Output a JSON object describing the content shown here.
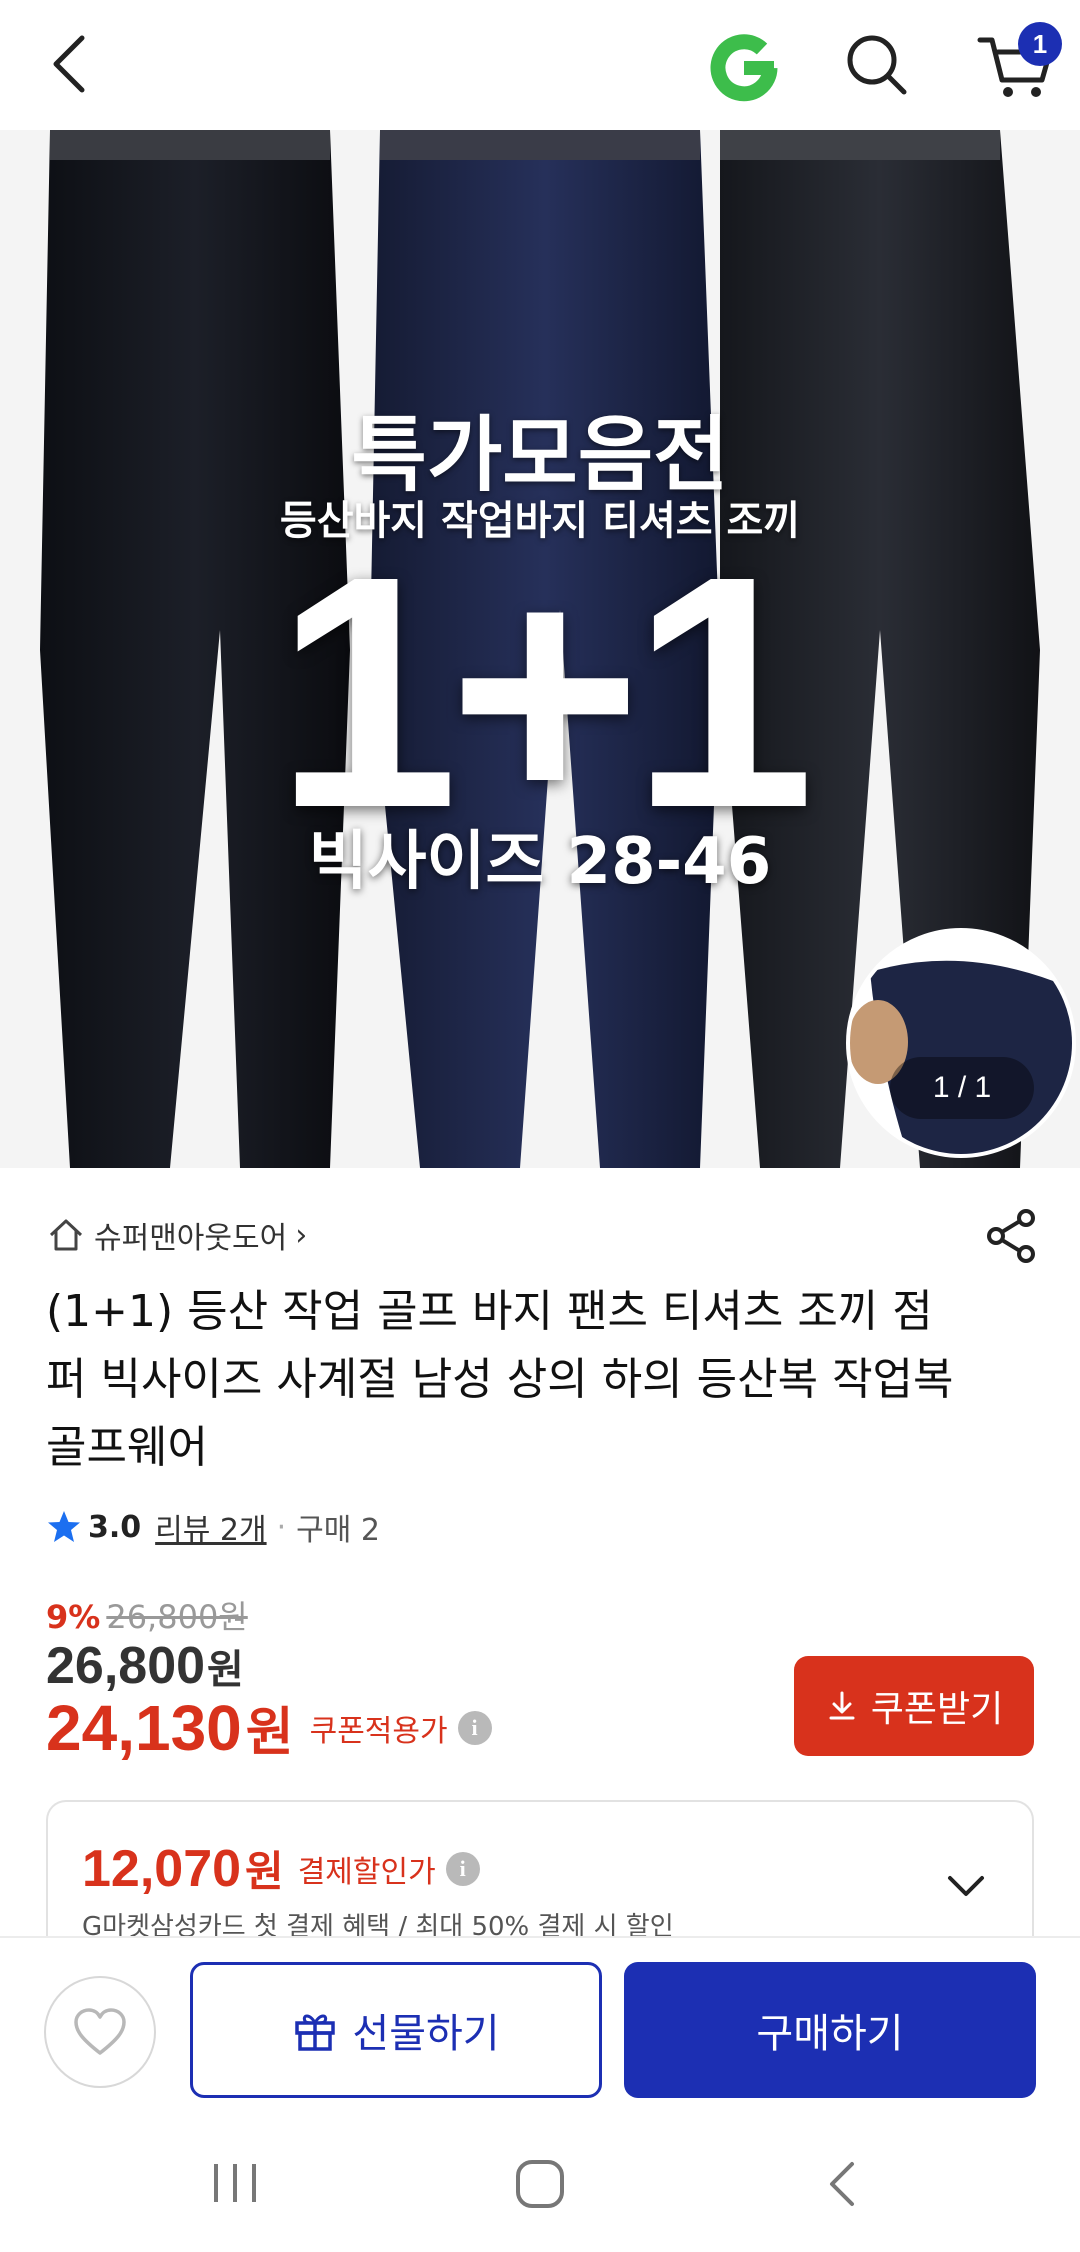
{
  "header": {
    "cart_count": "1"
  },
  "hero": {
    "headline": "특가모음전",
    "subheadline": "등산바지 작업바지 티셔츠 조끼",
    "promo": "1+1",
    "size_text": "빅사이즈 28-46",
    "pager": "1 / 1"
  },
  "product": {
    "store_name": "슈퍼맨아웃도어",
    "store_arrow": "›",
    "title": "(1+1) 등산 작업 골프 바지 팬츠 티셔츠 조끼 점퍼 빅사이즈 사계절 남성 상의 하의 등산복 작업복 골프웨어",
    "rating": "3.0",
    "review_text": "리뷰 2개",
    "dot": "·",
    "purchase_text": "구매 2"
  },
  "price": {
    "discount_rate": "9%",
    "original_price": "26,800원",
    "price": "26,800",
    "price_unit": "원",
    "coupon_price": "24,130",
    "coupon_unit": "원",
    "coupon_label": "쿠폰적용가",
    "coupon_button": "쿠폰받기"
  },
  "card_offer": {
    "price": "12,070",
    "unit": "원",
    "label": "결제할인가",
    "description": "G마켓삼성카드 첫 결제 혜택 / 최대 50% 결제 시 할인"
  },
  "actions": {
    "gift_label": "선물하기",
    "buy_label": "구매하기"
  },
  "colors": {
    "brand_blue": "#1c2fb3",
    "sale_red": "#d8321c",
    "gmarket_green": "#3dbd4b"
  },
  "icons": [
    "back-arrow-icon",
    "gmarket-logo-icon",
    "search-icon",
    "cart-icon",
    "home-icon",
    "share-icon",
    "star-icon",
    "info-icon",
    "download-icon",
    "chevron-down-icon",
    "heart-icon",
    "gift-icon",
    "recents-icon",
    "home-nav-icon",
    "back-nav-icon"
  ]
}
